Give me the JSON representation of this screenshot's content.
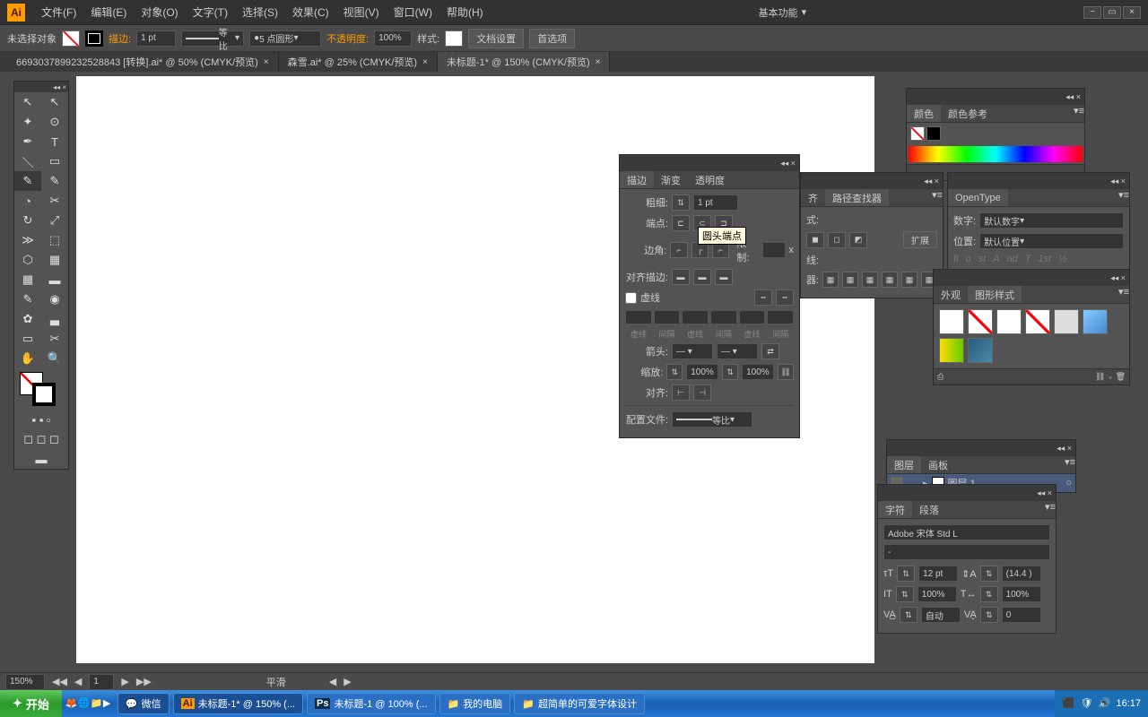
{
  "menubar": {
    "items": [
      "文件(F)",
      "编辑(E)",
      "对象(O)",
      "文字(T)",
      "选择(S)",
      "效果(C)",
      "视图(V)",
      "窗口(W)",
      "帮助(H)"
    ],
    "workspace": "基本功能"
  },
  "optionsbar": {
    "noselection": "未选择对象",
    "stroke_label": "描边:",
    "stroke_weight": "1 pt",
    "profile": "等比",
    "brush": "5 点圆形",
    "opacity_label": "不透明度:",
    "opacity": "100%",
    "style_label": "样式:",
    "doc_setup": "文档设置",
    "prefs": "首选项"
  },
  "doctabs": [
    "6693037899232528843 [转换].ai* @ 50% (CMYK/预览)",
    "森雪.ai* @ 25% (CMYK/预览)",
    "未标题-1* @ 150% (CMYK/预览)"
  ],
  "stroke_panel": {
    "tabs": [
      "描边",
      "渐变",
      "透明度"
    ],
    "weight_label": "粗细:",
    "weight": "1 pt",
    "cap_label": "端点:",
    "corner_label": "边角:",
    "limit_label": "限制:",
    "limit": "",
    "limit_x": "x",
    "align_label": "对齐描边:",
    "dashed_label": "虚线",
    "dash_cols": [
      "虚线",
      "间隔",
      "虚线",
      "间隔",
      "虚线",
      "间隔"
    ],
    "arrow_label": "箭头:",
    "scale_label": "缩放:",
    "scale1": "100%",
    "scale2": "100%",
    "arrow_align_label": "对齐:",
    "profile_label": "配置文件:",
    "profile": "等比",
    "tooltip": "圆头端点"
  },
  "color_panel": {
    "tabs": [
      "颜色",
      "颜色参考"
    ]
  },
  "pathfinder_panel": {
    "tabs": [
      "齐",
      "路径查找器"
    ],
    "expand": "扩展",
    "row1": "式:",
    "row2": "线:",
    "row3": "器:"
  },
  "opentype_panel": {
    "tab": "OpenType",
    "digits_label": "数字:",
    "digits": "默认数字",
    "position_label": "位置:",
    "position": "默认位置"
  },
  "appearance_panel": {
    "tabs": [
      "外观",
      "图形样式"
    ]
  },
  "layers_panel": {
    "tabs": [
      "图层",
      "画板"
    ],
    "layer_name": "图层 1"
  },
  "char_panel": {
    "tabs": [
      "字符",
      "段落"
    ],
    "font": "Adobe 宋体 Std L",
    "style": "-",
    "size": "12 pt",
    "leading": "(14.4 )",
    "hscale": "100%",
    "vscale": "100%",
    "kerning": "自动",
    "tracking": "0"
  },
  "statusbar": {
    "zoom": "150%",
    "artboard": "1",
    "mode": "平滑"
  },
  "taskbar": {
    "start": "开始",
    "items": [
      "微信",
      "未标题-1* @ 150% (...",
      "未标题-1 @ 100% (...",
      "我的电脑",
      "超简单的可爱字体设计"
    ],
    "time": "16:17"
  }
}
